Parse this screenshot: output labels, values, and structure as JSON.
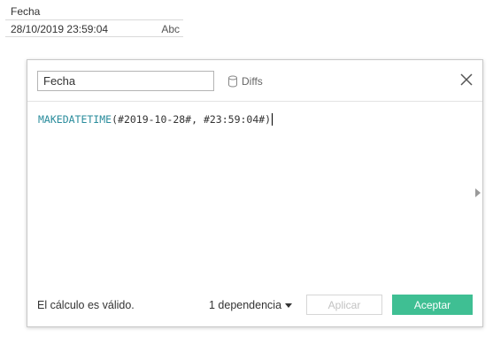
{
  "field": {
    "name": "Fecha",
    "value": "28/10/2019 23:59:04",
    "type_label": "Abc"
  },
  "dialog": {
    "calc_name": "Fecha",
    "diffs_label": "Diffs",
    "formula": {
      "function": "MAKEDATETIME",
      "args": "(#2019-10-28#, #23:59:04#)"
    },
    "status": "El cálculo es válido.",
    "dependencies_label": "1 dependencia",
    "apply_label": "Aplicar",
    "accept_label": "Aceptar"
  },
  "colors": {
    "function_keyword": "#2a8c9c",
    "accept_button": "#3fbf93",
    "disabled_text": "#c2c2c2"
  },
  "icons": {
    "diffs": "database-icon",
    "close": "close-icon",
    "dependencies": "caret-down-icon",
    "scroll": "arrow-right-icon"
  }
}
